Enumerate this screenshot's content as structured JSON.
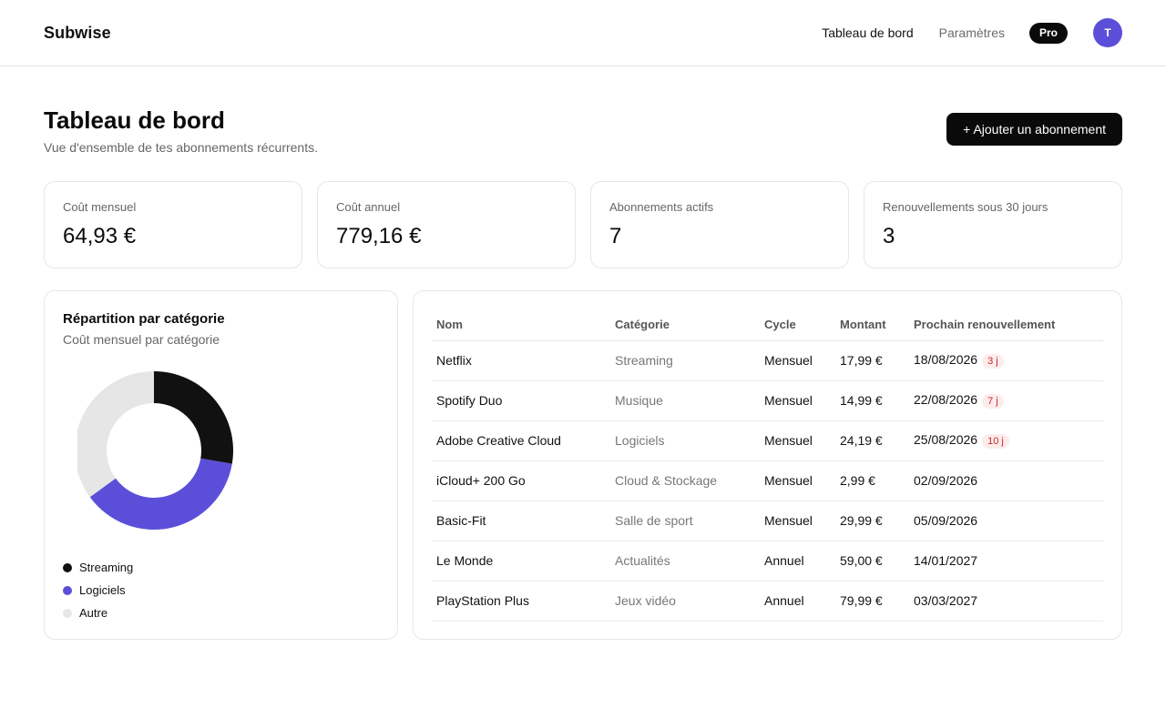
{
  "app": {
    "brand": "Subwise"
  },
  "nav": {
    "dashboard": "Tableau de bord",
    "settings": "Paramètres",
    "plan_badge": "Pro",
    "avatar_initial": "T"
  },
  "header": {
    "title": "Tableau de bord",
    "subtitle": "Vue d'ensemble de tes abonnements récurrents.",
    "add_button": "+ Ajouter un abonnement"
  },
  "stats": [
    {
      "label": "Coût mensuel",
      "value": "64,93 €"
    },
    {
      "label": "Coût annuel",
      "value": "779,16 €"
    },
    {
      "label": "Abonnements actifs",
      "value": "7"
    },
    {
      "label": "Renouvellements sous 30 jours",
      "value": "3"
    }
  ],
  "chart": {
    "title": "Répartition par catégorie",
    "subtitle": "Coût mensuel par catégorie"
  },
  "chart_data": {
    "type": "pie",
    "categories": [
      "Streaming",
      "Logiciels",
      "Autre"
    ],
    "values": [
      17.99,
      24.19,
      22.75
    ],
    "colors": [
      "#111111",
      "#5b4fd9",
      "#e6e6e6"
    ],
    "legend": "bottom"
  },
  "table": {
    "headers": [
      "Nom",
      "Catégorie",
      "Cycle",
      "Montant",
      "Prochain renouvellement"
    ],
    "rows": [
      {
        "name": "Netflix",
        "category": "Streaming",
        "cycle": "Mensuel",
        "amount": "17,99 €",
        "renewal": "18/08/2026",
        "badge": "3 j"
      },
      {
        "name": "Spotify Duo",
        "category": "Musique",
        "cycle": "Mensuel",
        "amount": "14,99 €",
        "renewal": "22/08/2026",
        "badge": "7 j"
      },
      {
        "name": "Adobe Creative Cloud",
        "category": "Logiciels",
        "cycle": "Mensuel",
        "amount": "24,19 €",
        "renewal": "25/08/2026",
        "badge": "10 j"
      },
      {
        "name": "iCloud+ 200 Go",
        "category": "Cloud & Stockage",
        "cycle": "Mensuel",
        "amount": "2,99 €",
        "renewal": "02/09/2026",
        "badge": ""
      },
      {
        "name": "Basic-Fit",
        "category": "Salle de sport",
        "cycle": "Mensuel",
        "amount": "29,99 €",
        "renewal": "05/09/2026",
        "badge": ""
      },
      {
        "name": "Le Monde",
        "category": "Actualités",
        "cycle": "Annuel",
        "amount": "59,00 €",
        "renewal": "14/01/2027",
        "badge": ""
      },
      {
        "name": "PlayStation Plus",
        "category": "Jeux vidéo",
        "cycle": "Annuel",
        "amount": "79,99 €",
        "renewal": "03/03/2027",
        "badge": ""
      }
    ]
  }
}
